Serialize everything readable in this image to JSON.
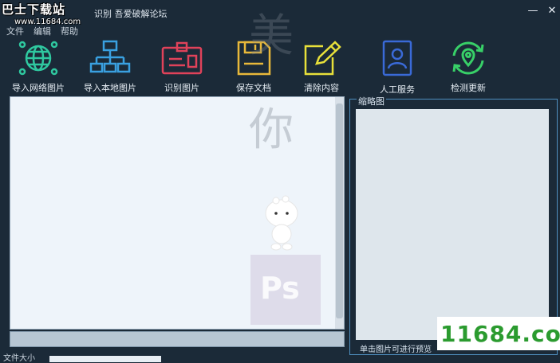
{
  "window": {
    "title": "识别 吾爱破解论坛",
    "minimize": "—",
    "close": "✕"
  },
  "watermark": {
    "logo": "巴士下载站",
    "url": "www.11684.com",
    "site_badge": "11684.com"
  },
  "menu": [
    "文件",
    "编辑",
    "帮助"
  ],
  "toolbar": [
    {
      "label": "导入网络图片",
      "icon": "globe-network-icon",
      "color": "#2fc9a0"
    },
    {
      "label": "导入本地图片",
      "icon": "local-network-icon",
      "color": "#3aa0e0"
    },
    {
      "label": "识别图片",
      "icon": "id-card-icon",
      "color": "#e0425a"
    },
    {
      "label": "保存文档",
      "icon": "floppy-save-icon",
      "color": "#e8b83a"
    },
    {
      "label": "清除内容",
      "icon": "edit-clear-icon",
      "color": "#e8e03a"
    },
    {
      "label": "人工服务",
      "icon": "person-card-icon",
      "color": "#3a6ad8"
    },
    {
      "label": "检测更新",
      "icon": "refresh-location-icon",
      "color": "#38d068"
    }
  ],
  "thumbnail": {
    "legend": "缩略图",
    "hint": "单击图片可进行预览"
  },
  "overlay": {
    "char1": "美",
    "char2": "你",
    "ps": "Ps"
  },
  "status": {
    "label": "文件大小"
  }
}
